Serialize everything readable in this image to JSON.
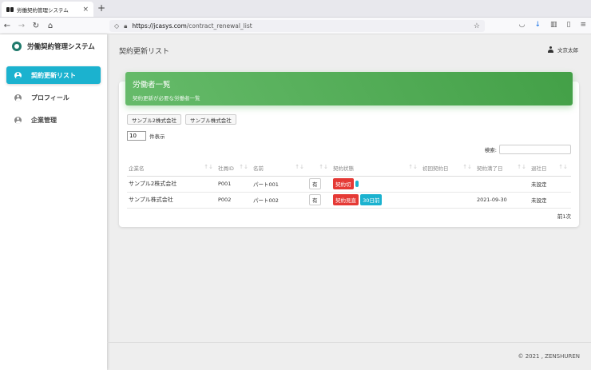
{
  "browser": {
    "tab_title": "労働契約管理システム",
    "tab_close": "×",
    "new_tab": "+",
    "url_host": "https://jcasys.com",
    "url_path": "/contract_renewal_list"
  },
  "sidebar": {
    "brand": "労働契約管理システム",
    "items": [
      {
        "label": "契約更新リスト",
        "icon": "user-circle-icon",
        "active": true
      },
      {
        "label": "プロフィール",
        "icon": "user-circle-icon",
        "active": false
      },
      {
        "label": "企業管理",
        "icon": "user-circle-icon",
        "active": false
      }
    ]
  },
  "header": {
    "page_title": "契約更新リスト",
    "user_name": "文京太郎"
  },
  "card": {
    "title": "労働者一覧",
    "subtitle": "契約更新が必要な労働者一覧",
    "filters": [
      "サンプル2株式会社",
      "サンプル株式会社"
    ],
    "length_value": "10",
    "length_label": "件表示",
    "search_label": "検索:",
    "columns": [
      "企業名",
      "社員ID",
      "名前",
      "",
      "契約状態",
      "初回契約日",
      "契約満了日",
      "退社日"
    ],
    "rows": [
      {
        "company": "サンプル2株式会社",
        "id": "P001",
        "name": "パート001",
        "flag": "有",
        "status": "契約切",
        "status2": "",
        "first_date": "",
        "end_date": "",
        "leave": "未設定"
      },
      {
        "company": "サンプル株式会社",
        "id": "P002",
        "name": "パート002",
        "flag": "有",
        "status": "契約見直",
        "status2": "30日前",
        "first_date": "",
        "end_date": "2021-09-30",
        "leave": "未設定"
      }
    ],
    "paging": "前1次"
  },
  "footer": {
    "copyright": "© 2021 , ZENSHUREN"
  },
  "colors": {
    "accent": "#1bb2cf",
    "header_green": "#4caf50",
    "badge_red": "#e53935"
  }
}
